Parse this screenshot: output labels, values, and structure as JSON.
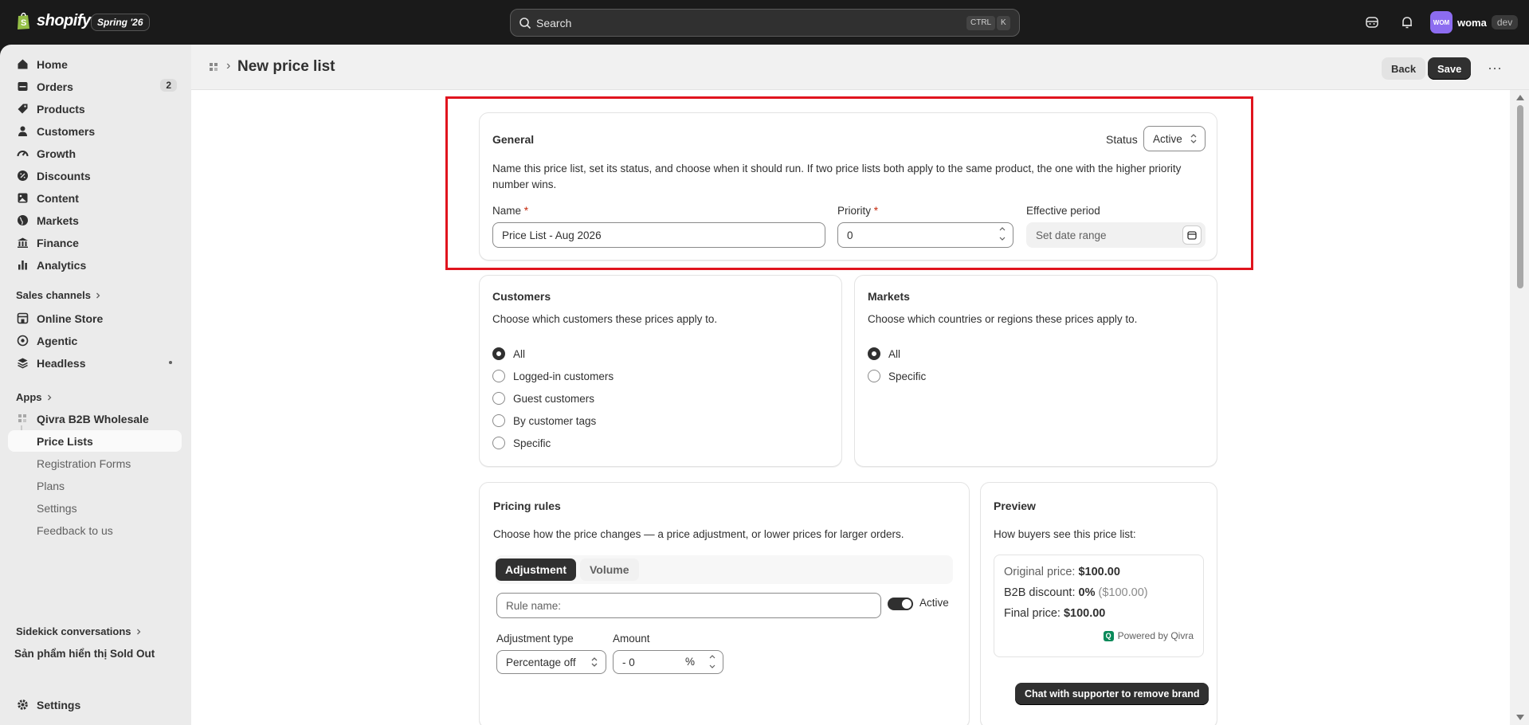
{
  "topbar": {
    "brand": "shopify",
    "edition_badge": "Spring '26",
    "search_placeholder": "Search",
    "shortcut_ctrl": "CTRL",
    "shortcut_k": "K",
    "user_initials": "WOM",
    "user_name": "woma",
    "user_badge": "dev"
  },
  "sidebar": {
    "items": [
      {
        "label": "Home",
        "icon": "home-icon"
      },
      {
        "label": "Orders",
        "icon": "orders-icon",
        "badge": "2"
      },
      {
        "label": "Products",
        "icon": "tag-icon"
      },
      {
        "label": "Customers",
        "icon": "person-icon"
      },
      {
        "label": "Growth",
        "icon": "gauge-icon"
      },
      {
        "label": "Discounts",
        "icon": "discount-icon"
      },
      {
        "label": "Content",
        "icon": "content-icon"
      },
      {
        "label": "Markets",
        "icon": "globe-icon"
      },
      {
        "label": "Finance",
        "icon": "bank-icon"
      },
      {
        "label": "Analytics",
        "icon": "bar-chart-icon"
      }
    ],
    "sales_channels_label": "Sales channels",
    "channels": [
      {
        "label": "Online Store",
        "icon": "store-icon"
      },
      {
        "label": "Agentic",
        "icon": "agentic-icon"
      },
      {
        "label": "Headless",
        "icon": "headless-icon"
      }
    ],
    "apps_label": "Apps",
    "app_name": "Qivra B2B Wholesale",
    "app_pages": [
      "Price Lists",
      "Registration Forms",
      "Plans",
      "Settings",
      "Feedback to us"
    ],
    "sidekick_label": "Sidekick conversations",
    "sidekick_item": "Sản phẩm hiển thị Sold Out",
    "settings_label": "Settings"
  },
  "header": {
    "title": "New price list",
    "back_label": "Back",
    "save_label": "Save",
    "more_label": "⋯"
  },
  "general": {
    "title": "General",
    "status_label": "Status",
    "status_value": "Active",
    "description": "Name this price list, set its status, and choose when it should run. If two price lists both apply to the same product, the one with the higher priority number wins.",
    "name_label": "Name",
    "name_value": "Price List - Aug 2026",
    "priority_label": "Priority",
    "priority_value": "0",
    "period_label": "Effective period",
    "period_placeholder": "Set date range",
    "required_mark": "*"
  },
  "customers": {
    "title": "Customers",
    "description": "Choose which customers these prices apply to.",
    "options": [
      "All",
      "Logged-in customers",
      "Guest customers",
      "By customer tags",
      "Specific"
    ],
    "selected": "All"
  },
  "markets": {
    "title": "Markets",
    "description": "Choose which countries or regions these prices apply to.",
    "options": [
      "All",
      "Specific"
    ],
    "selected": "All"
  },
  "pricing": {
    "title": "Pricing rules",
    "description": "Choose how the price changes — a price adjustment, or lower prices for larger orders.",
    "tabs": [
      "Adjustment",
      "Volume"
    ],
    "rule_name_placeholder": "Rule name:",
    "active_label": "Active",
    "adjustment_type_label": "Adjustment type",
    "adjustment_type_value": "Percentage off",
    "amount_label": "Amount",
    "amount_value": "- 0",
    "amount_unit": "%"
  },
  "preview": {
    "title": "Preview",
    "description": "How buyers see this price list:",
    "original_label": "Original price:",
    "original_value": "$100.00",
    "discount_label": "B2B discount:",
    "discount_value": "0%",
    "discount_amount": "($100.00)",
    "final_label": "Final price:",
    "final_value": "$100.00",
    "powered_by": "Powered by Qivra",
    "chat_button": "Chat with supporter to remove brand"
  },
  "colors": {
    "highlight": "#e0141e",
    "topbar": "#1a1a1a",
    "accent": "#303030"
  }
}
